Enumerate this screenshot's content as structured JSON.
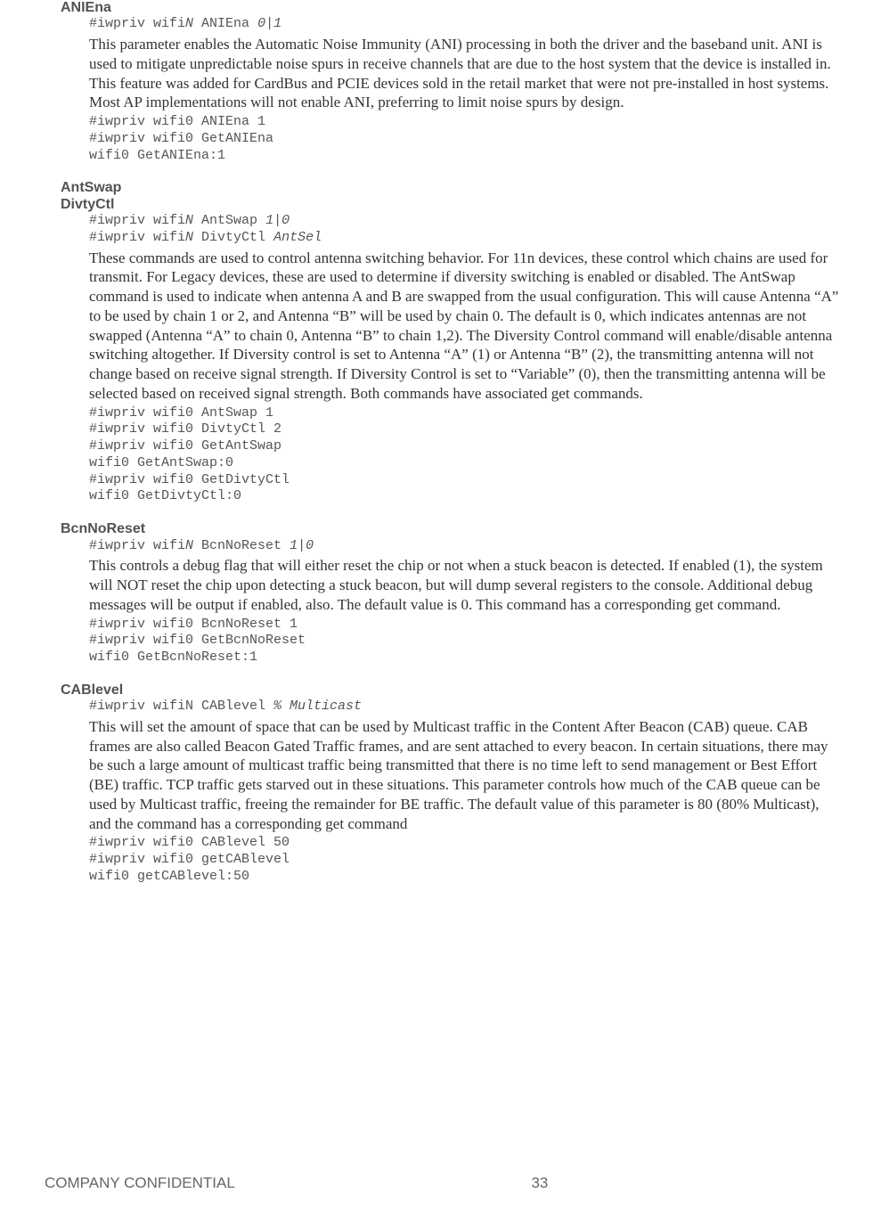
{
  "sections": [
    {
      "title_lines": [
        "ANIEna"
      ],
      "syntax_html": "#iwpriv wifi<span class=\"i\">N</span> ANIEna <span class=\"i\">0|1</span>",
      "description": "This parameter enables the Automatic Noise Immunity (ANI) processing in both the driver and the baseband unit. ANI is used to mitigate unpredictable noise spurs in receive channels that are due to the host system that the device is installed in. This feature was added for CardBus and PCIE devices sold in the retail market that were not pre-installed in host systems. Most AP implementations will not enable ANI, preferring to limit noise spurs by design.",
      "example": "#iwpriv wifi0 ANIEna 1\n#iwpriv wifi0 GetANIEna\nwifi0 GetANIEna:1"
    },
    {
      "title_lines": [
        "AntSwap",
        "DivtyCtl"
      ],
      "syntax_html": "#iwpriv wifi<span class=\"i\">N</span> AntSwap <span class=\"i\">1|0</span>\n#iwpriv wifi<span class=\"i\">N</span> DivtyCtl <span class=\"i\">AntSel</span>",
      "description": "These commands are used to control antenna switching behavior. For 11n devices, these control which chains are used for transmit. For Legacy devices, these are used to determine if diversity switching is enabled or disabled. The AntSwap command is used to indicate when antenna A and B are swapped from the usual configuration. This will cause Antenna “A” to be used by chain 1 or 2, and Antenna “B” will be used by chain 0. The default is 0, which indicates antennas are not swapped (Antenna “A” to chain 0, Antenna “B” to chain 1,2). The Diversity Control command will enable/disable antenna switching altogether. If Diversity control is set to Antenna “A” (1) or Antenna “B” (2), the transmitting antenna will not change based on receive signal strength. If Diversity Control is set to “Variable” (0), then the transmitting antenna will be selected based on received signal strength. Both commands have associated get commands.",
      "example": "#iwpriv wifi0 AntSwap 1\n#iwpriv wifi0 DivtyCtl 2\n#iwpriv wifi0 GetAntSwap\nwifi0 GetAntSwap:0\n#iwpriv wifi0 GetDivtyCtl\nwifi0 GetDivtyCtl:0"
    },
    {
      "title_lines": [
        "BcnNoReset"
      ],
      "syntax_html": "#iwpriv wifi<span class=\"i\">N</span> BcnNoReset <span class=\"i\">1|0</span>",
      "description": "This controls a debug flag that will either reset the chip or not when a stuck beacon is detected. If enabled (1), the system will NOT reset the chip upon detecting a stuck beacon, but will dump several registers to the console. Additional debug messages will be output if enabled, also. The default value is 0. This command has a corresponding get command.",
      "example": "#iwpriv wifi0 BcnNoReset 1\n#iwpriv wifi0 GetBcnNoReset\nwifi0 GetBcnNoReset:1"
    },
    {
      "title_lines": [
        "CABlevel"
      ],
      "syntax_html": "#iwpriv wifiN CABlevel <span class=\"i\">% Multicast</span>",
      "description": "This will set the amount of space that can be used by Multicast traffic in the Content After Beacon (CAB) queue. CAB frames are also called Beacon Gated Traffic frames, and are sent attached to every beacon. In certain situations, there may be such a large amount of multicast traffic being transmitted that there is no time left to send management or Best Effort (BE) traffic. TCP traffic gets starved out in these situations. This parameter controls how much of the CAB queue can be used by Multicast traffic, freeing the remainder for BE traffic. The default value of this parameter is 80 (80% Multicast), and the command has a corresponding get command",
      "example": "#iwpriv wifi0 CABlevel 50\n#iwpriv wifi0 getCABlevel\nwifi0 getCABlevel:50"
    }
  ],
  "footer": {
    "left": "COMPANY CONFIDENTIAL",
    "center": "33"
  }
}
